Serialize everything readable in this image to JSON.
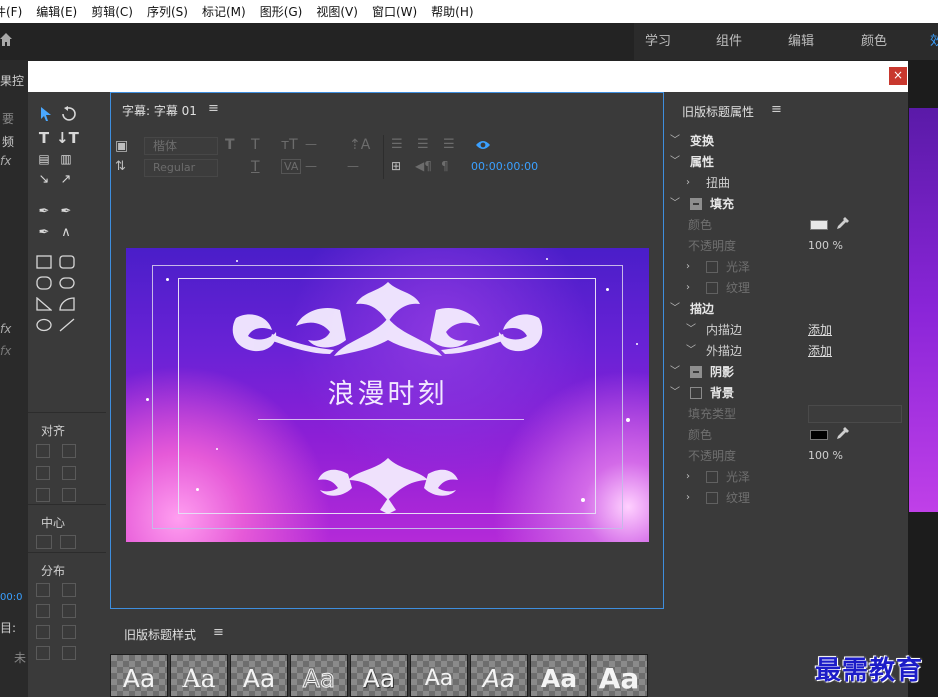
{
  "menu": [
    "件(F)",
    "编辑(E)",
    "剪辑(C)",
    "序列(S)",
    "标记(M)",
    "图形(G)",
    "视图(V)",
    "窗口(W)",
    "帮助(H)"
  ],
  "workspaces": [
    "学习",
    "组件",
    "编辑",
    "颜色",
    "效"
  ],
  "bg_left_labels": [
    "果控",
    "要",
    "频",
    "fx",
    "fx",
    "fx",
    "目:",
    "未",
    "00:0"
  ],
  "dialog": {
    "close_label": "×"
  },
  "tools": {
    "align_label": "对齐",
    "center_label": "中心",
    "distribute_label": "分布"
  },
  "main_panel": {
    "title": "字幕: 字幕 01",
    "menu_icon": "≡",
    "font_family": "楷体",
    "font_style": "Regular",
    "tt_dash": "—",
    "va_dash": "—",
    "timecode": "00:00:00:00",
    "headline": "浪漫时刻"
  },
  "styles_panel": {
    "title": "旧版标题样式",
    "menu_icon": "≡",
    "swatches": [
      "Aa",
      "Aa",
      "Aa",
      "Aa",
      "Aa",
      "Aa",
      "Aa",
      "Aa",
      "Aa"
    ]
  },
  "properties": {
    "title": "旧版标题属性",
    "menu_icon": "≡",
    "transform": "变换",
    "attributes": "属性",
    "distort": "扭曲",
    "fill": "填充",
    "fill_color": "颜色",
    "fill_opacity": "不透明度",
    "fill_opacity_value": "100 %",
    "sheen": "光泽",
    "texture": "纹理",
    "stroke": "描边",
    "inner_stroke": "内描边",
    "outer_stroke": "外描边",
    "add_label": "添加",
    "shadow": "阴影",
    "background": "背景",
    "fill_type": "填充类型",
    "bg_color": "颜色",
    "bg_opacity": "不透明度",
    "bg_opacity_value": "100 %",
    "bg_sheen": "光泽",
    "bg_texture": "纹理"
  },
  "colors": {
    "accent": "#3e8ede",
    "timecode": "#3aa0ff",
    "fill_color_swatch": "#e8e8e8",
    "bg_color_swatch": "#000000",
    "close_button": "#c8382e"
  },
  "watermark": "最需教育"
}
